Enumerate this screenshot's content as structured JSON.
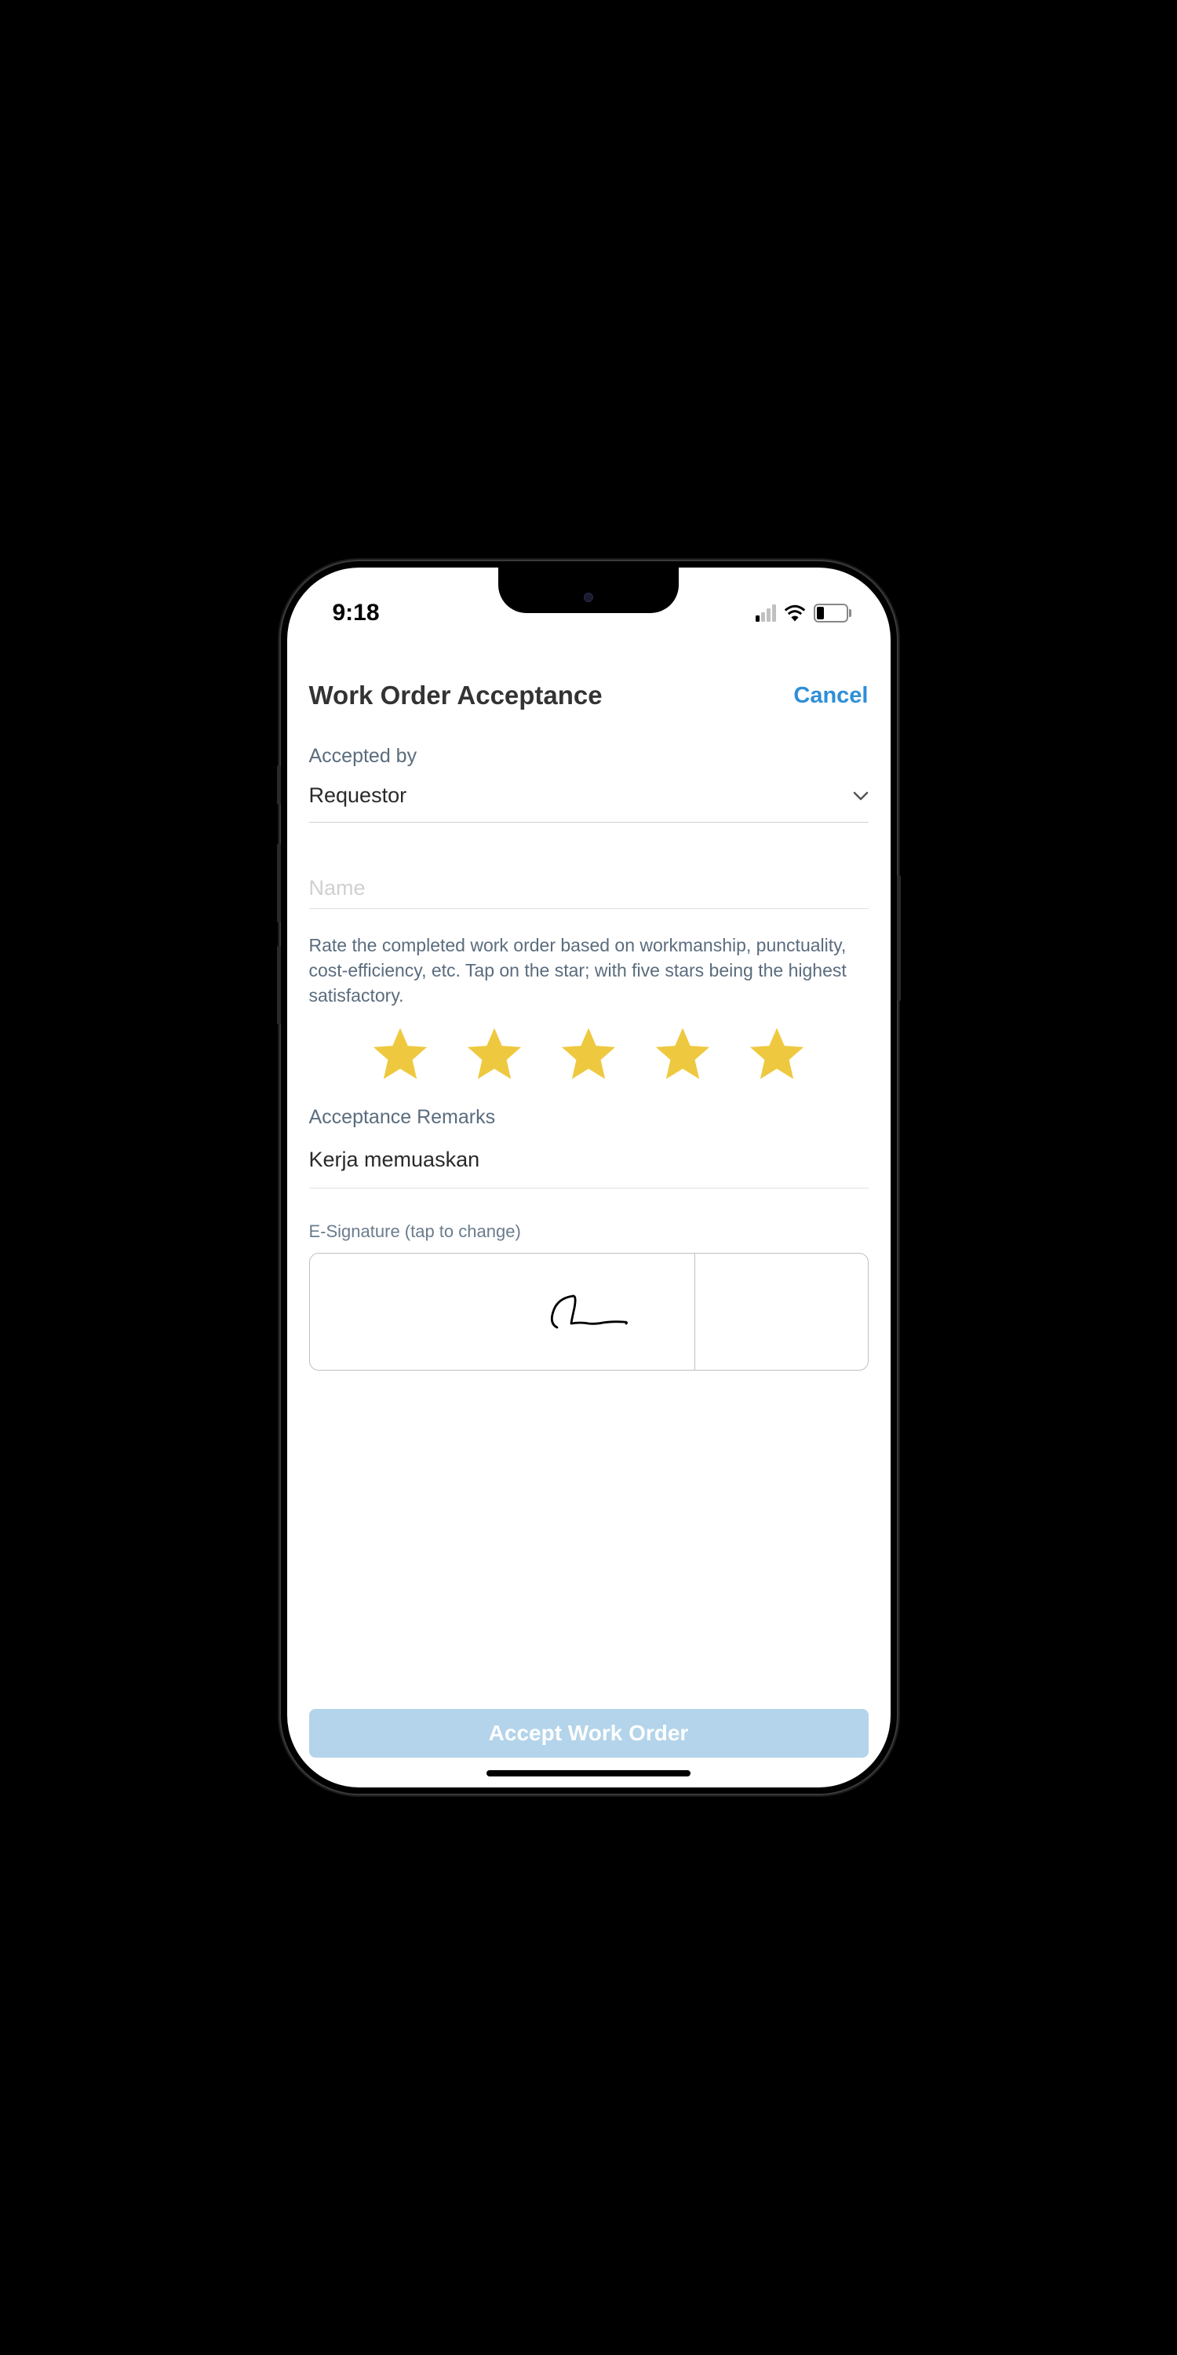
{
  "statusBar": {
    "time": "9:18",
    "batteryPercent": "23"
  },
  "header": {
    "title": "Work Order Acceptance",
    "cancelLabel": "Cancel"
  },
  "acceptedBy": {
    "label": "Accepted by",
    "value": "Requestor"
  },
  "nameField": {
    "placeholder": "Name",
    "value": ""
  },
  "rating": {
    "instructions": "Rate the completed work order based on workmanship, punctuality, cost-efficiency, etc. Tap on the star; with five stars being the highest satisfactory.",
    "value": 5,
    "maxStars": 5
  },
  "remarks": {
    "label": "Acceptance Remarks",
    "value": "Kerja memuaskan"
  },
  "signature": {
    "label": "E-Signature (tap to change)",
    "hasSignature": true
  },
  "acceptButton": {
    "label": "Accept Work Order"
  },
  "colors": {
    "accent": "#2e8fd8",
    "buttonBg": "#b3d4ea",
    "starFill": "#eec940"
  }
}
